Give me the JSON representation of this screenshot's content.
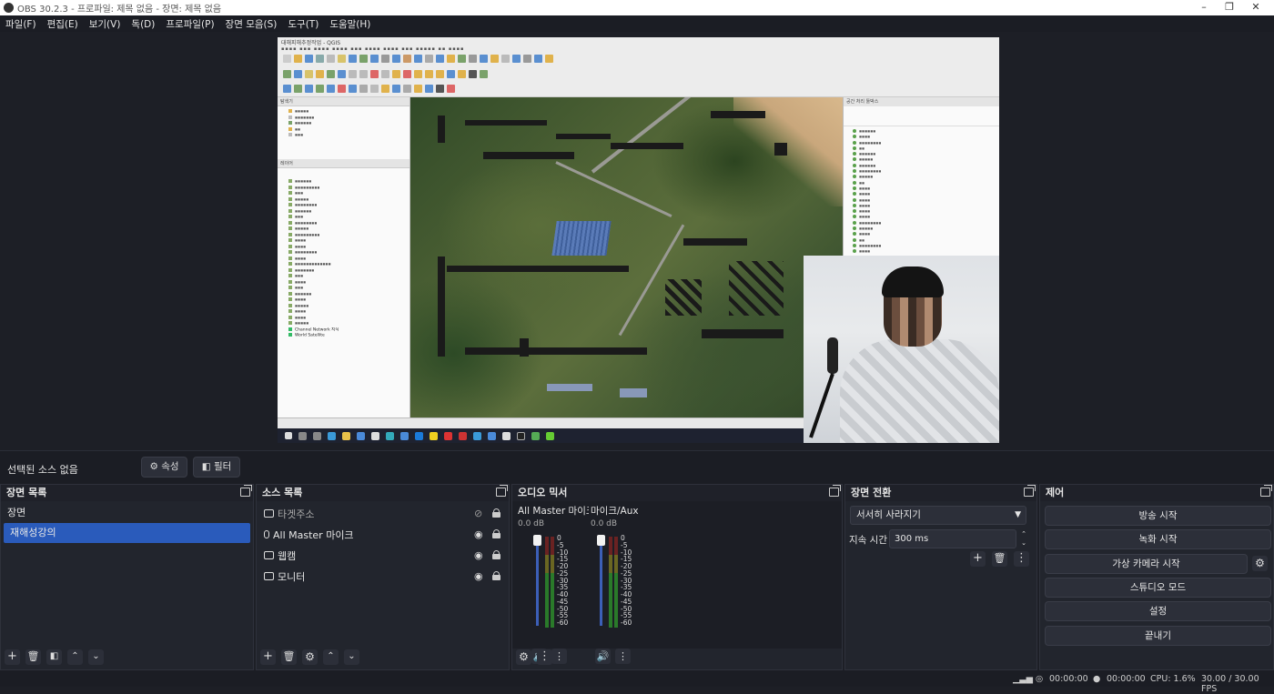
{
  "window": {
    "title": "OBS 30.2.3 - 프로파일: 제목 없음 - 장면: 제목 없음"
  },
  "menu": [
    "파일(F)",
    "편집(E)",
    "보기(V)",
    "독(D)",
    "프로파일(P)",
    "장면 모음(S)",
    "도구(T)",
    "도움말(H)"
  ],
  "preview": {
    "captured_window_title": "대해피해추정작업 - QGIS",
    "left_panel_headers": [
      "탐색기",
      "레이어"
    ],
    "layers_bottom": [
      "Channel Network 지식",
      "World Satellite"
    ],
    "right_panel_header": "공간 처리 툴박스"
  },
  "source_bar": {
    "no_source": "선택된 소스 없음",
    "properties": "속성",
    "filters": "필터"
  },
  "scenes": {
    "title": "장면 목록",
    "items": [
      "장면",
      "재해성강의"
    ],
    "selected": 1
  },
  "sources": {
    "title": "소스 목록",
    "items": [
      {
        "name": "타겟주소",
        "visible": false,
        "icon": "image-icon"
      },
      {
        "name": "All Master 마이크",
        "visible": true,
        "icon": "microphone-icon"
      },
      {
        "name": "웹캠",
        "visible": true,
        "icon": "camera-icon"
      },
      {
        "name": "모니터",
        "visible": true,
        "icon": "monitor-icon"
      }
    ]
  },
  "mixer": {
    "title": "오디오 믹서",
    "channels": [
      {
        "name": "All Master 마이크",
        "db": "0.0 dB"
      },
      {
        "name": "마이크/Aux",
        "db": "0.0 dB"
      }
    ],
    "ticks": [
      "0",
      "-5",
      "-10",
      "-15",
      "-20",
      "-25",
      "-30",
      "-35",
      "-40",
      "-45",
      "-50",
      "-55",
      "-60"
    ]
  },
  "transitions": {
    "title": "장면 전환",
    "selected": "서서히 사라지기",
    "duration_label": "지속 시간",
    "duration": "300 ms"
  },
  "controls": {
    "title": "제어",
    "buttons": [
      "방송 시작",
      "녹화 시작",
      "가상 카메라 시작",
      "스튜디오 모드",
      "설정",
      "끝내기"
    ]
  },
  "status": {
    "stream_time": "00:00:00",
    "rec_time": "00:00:00",
    "cpu": "CPU: 1.6%",
    "fps": "30.00 / 30.00 FPS"
  }
}
